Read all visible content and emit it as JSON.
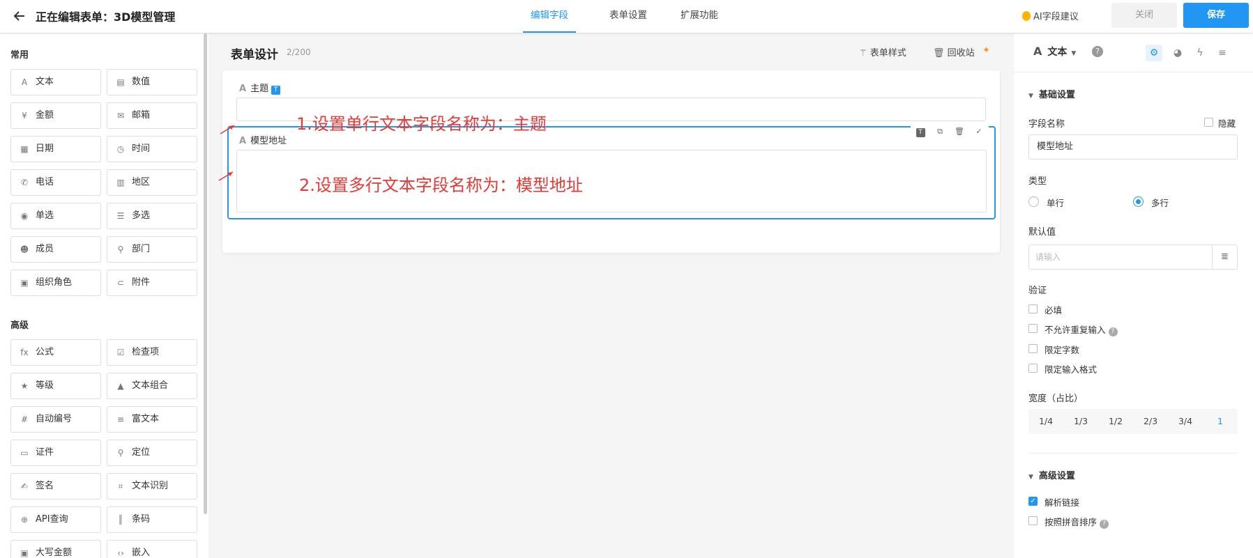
{
  "header": {
    "title": "正在编辑表单：3D模型管理",
    "tabs": [
      "编辑字段",
      "表单设置",
      "扩展功能"
    ],
    "ai_label": "AI字段建议",
    "close_label": "关闭",
    "save_label": "保存"
  },
  "palette": {
    "common_title": "常用",
    "advanced_title": "高级",
    "common": [
      {
        "label": "文本",
        "icon": "text-a-icon"
      },
      {
        "label": "数值",
        "icon": "number-icon"
      },
      {
        "label": "金额",
        "icon": "currency-icon"
      },
      {
        "label": "邮箱",
        "icon": "mail-icon"
      },
      {
        "label": "日期",
        "icon": "calendar-icon"
      },
      {
        "label": "时间",
        "icon": "clock-icon"
      },
      {
        "label": "电话",
        "icon": "phone-icon"
      },
      {
        "label": "地区",
        "icon": "map-icon"
      },
      {
        "label": "单选",
        "icon": "radio-icon"
      },
      {
        "label": "多选",
        "icon": "checklist-icon"
      },
      {
        "label": "成员",
        "icon": "member-icon"
      },
      {
        "label": "部门",
        "icon": "org-tree-icon"
      },
      {
        "label": "组织角色",
        "icon": "role-badge-icon"
      },
      {
        "label": "附件",
        "icon": "paperclip-icon"
      }
    ],
    "advanced": [
      {
        "label": "公式",
        "icon": "fx-icon"
      },
      {
        "label": "检查项",
        "icon": "checkbox-icon"
      },
      {
        "label": "等级",
        "icon": "star-icon"
      },
      {
        "label": "文本组合",
        "icon": "shapes-icon"
      },
      {
        "label": "自动编号",
        "icon": "hash-icon"
      },
      {
        "label": "富文本",
        "icon": "rich-text-icon"
      },
      {
        "label": "证件",
        "icon": "id-card-icon"
      },
      {
        "label": "定位",
        "icon": "location-pin-icon"
      },
      {
        "label": "签名",
        "icon": "signature-icon"
      },
      {
        "label": "文本识别",
        "icon": "scan-text-icon"
      },
      {
        "label": "API查询",
        "icon": "api-icon"
      },
      {
        "label": "条码",
        "icon": "barcode-icon"
      },
      {
        "label": "大写金额",
        "icon": "upper-amount-icon"
      },
      {
        "label": "嵌入",
        "icon": "embed-code-icon"
      }
    ]
  },
  "canvas": {
    "title": "表单设计",
    "count": "2/200",
    "style_label": "表单样式",
    "recycle_label": "回收站",
    "field1_label": "主题",
    "field1_badge": "T",
    "field2_label": "模型地址",
    "field2_badge": "T",
    "annotation1": "1.设置单行文本字段名称为：主题",
    "annotation2": "2.设置多行文本字段名称为：模型地址",
    "annotation_color": "#e53935"
  },
  "settings": {
    "type_label": "文本",
    "type_icon": "text-a-icon",
    "basic_title": "基础设置",
    "field_name_label": "字段名称",
    "hide_label": "隐藏",
    "field_name_value": "模型地址",
    "type_section_label": "类型",
    "type_single": "单行",
    "type_multi": "多行",
    "type_selected": "多行",
    "default_label": "默认值",
    "default_placeholder": "请输入",
    "validation_label": "验证",
    "required": "必填",
    "no_dup": "不允许重复输入",
    "limit_len": "限定字数",
    "limit_fmt": "限定输入格式",
    "width_label": "宽度（占比）",
    "width_options": [
      "1/4",
      "1/3",
      "1/2",
      "2/3",
      "3/4",
      "1"
    ],
    "width_selected": "1",
    "advanced_title": "高级设置",
    "parse_link": "解析链接",
    "parse_link_checked": true,
    "pinyin_sort": "按照拼音排序",
    "accent_color": "#2196f3"
  }
}
